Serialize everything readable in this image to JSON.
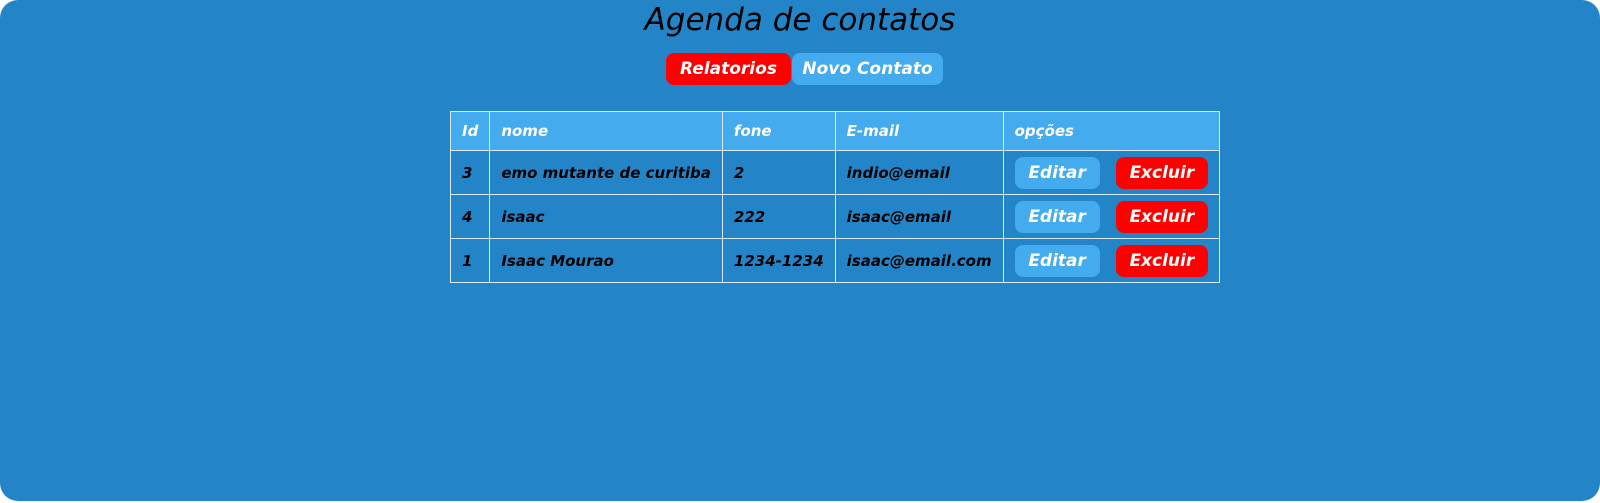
{
  "title": "Agenda de contatos",
  "nav": {
    "relatorios_label": "Relatorios",
    "novo_contato_label": "Novo Contato"
  },
  "table": {
    "headers": [
      "Id",
      "nome",
      "fone",
      "E-mail",
      "opções"
    ],
    "rows": [
      {
        "id": "3",
        "nome": "emo mutante de curitiba",
        "fone": "2",
        "email": "indio@email",
        "edit_label": "Editar",
        "delete_label": "Excluir"
      },
      {
        "id": "4",
        "nome": "isaac",
        "fone": "222",
        "email": "isaac@email",
        "edit_label": "Editar",
        "delete_label": "Excluir"
      },
      {
        "id": "1",
        "nome": "Isaac Mourao",
        "fone": "1234-1234",
        "email": "isaac@email.com",
        "edit_label": "Editar",
        "delete_label": "Excluir"
      }
    ]
  },
  "colors": {
    "background": "#2385c8",
    "accent_blue": "#45abef",
    "danger_red": "#ff0000"
  }
}
